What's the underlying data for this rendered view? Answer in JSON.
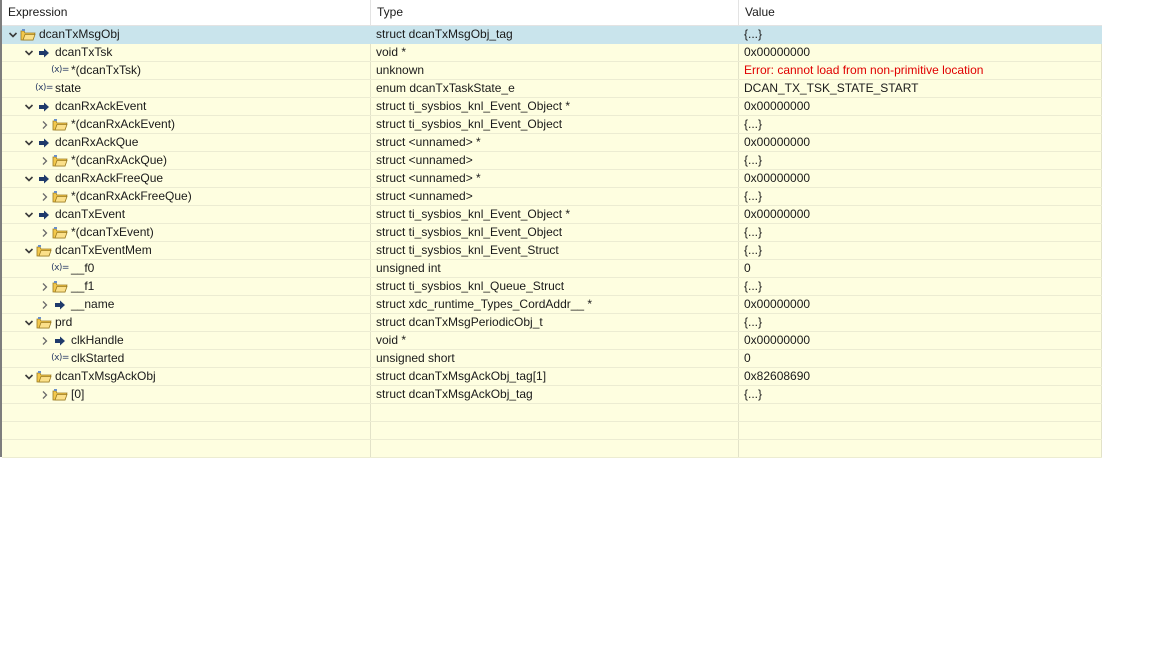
{
  "columns": {
    "expression": "Expression",
    "type": "Type",
    "value": "Value"
  },
  "rows": [
    {
      "depth": 0,
      "twisty": "expanded",
      "icon": "struct",
      "name": "dcanTxMsgObj",
      "type": "struct dcanTxMsgObj_tag",
      "value": "{...}",
      "selected": true
    },
    {
      "depth": 1,
      "twisty": "expanded",
      "icon": "pointer",
      "name": "dcanTxTsk",
      "type": "void *",
      "value": "0x00000000"
    },
    {
      "depth": 2,
      "twisty": "none",
      "icon": "variable",
      "name": "*(dcanTxTsk)",
      "type": "unknown",
      "value": "Error: cannot load from non-primitive location",
      "error": true
    },
    {
      "depth": 1,
      "twisty": "none",
      "icon": "variable",
      "name": "state",
      "type": "enum dcanTxTaskState_e",
      "value": "DCAN_TX_TSK_STATE_START"
    },
    {
      "depth": 1,
      "twisty": "expanded",
      "icon": "pointer",
      "name": "dcanRxAckEvent",
      "type": "struct ti_sysbios_knl_Event_Object *",
      "value": "0x00000000"
    },
    {
      "depth": 2,
      "twisty": "collapsed",
      "icon": "struct",
      "name": "*(dcanRxAckEvent)",
      "type": "struct ti_sysbios_knl_Event_Object",
      "value": "{...}"
    },
    {
      "depth": 1,
      "twisty": "expanded",
      "icon": "pointer",
      "name": "dcanRxAckQue",
      "type": "struct <unnamed> *",
      "value": "0x00000000"
    },
    {
      "depth": 2,
      "twisty": "collapsed",
      "icon": "struct",
      "name": "*(dcanRxAckQue)",
      "type": "struct <unnamed>",
      "value": "{...}"
    },
    {
      "depth": 1,
      "twisty": "expanded",
      "icon": "pointer",
      "name": "dcanRxAckFreeQue",
      "type": "struct <unnamed> *",
      "value": "0x00000000"
    },
    {
      "depth": 2,
      "twisty": "collapsed",
      "icon": "struct",
      "name": "*(dcanRxAckFreeQue)",
      "type": "struct <unnamed>",
      "value": "{...}"
    },
    {
      "depth": 1,
      "twisty": "expanded",
      "icon": "pointer",
      "name": "dcanTxEvent",
      "type": "struct ti_sysbios_knl_Event_Object *",
      "value": "0x00000000"
    },
    {
      "depth": 2,
      "twisty": "collapsed",
      "icon": "struct",
      "name": "*(dcanTxEvent)",
      "type": "struct ti_sysbios_knl_Event_Object",
      "value": "{...}"
    },
    {
      "depth": 1,
      "twisty": "expanded",
      "icon": "struct",
      "name": "dcanTxEventMem",
      "type": "struct ti_sysbios_knl_Event_Struct",
      "value": "{...}"
    },
    {
      "depth": 2,
      "twisty": "none",
      "icon": "variable",
      "name": "__f0",
      "type": "unsigned int",
      "value": "0"
    },
    {
      "depth": 2,
      "twisty": "collapsed",
      "icon": "struct",
      "name": "__f1",
      "type": "struct ti_sysbios_knl_Queue_Struct",
      "value": "{...}"
    },
    {
      "depth": 2,
      "twisty": "collapsed",
      "icon": "pointer",
      "name": "__name",
      "type": "struct xdc_runtime_Types_CordAddr__ *",
      "value": "0x00000000"
    },
    {
      "depth": 1,
      "twisty": "expanded",
      "icon": "struct",
      "name": "prd",
      "type": "struct dcanTxMsgPeriodicObj_t",
      "value": "{...}"
    },
    {
      "depth": 2,
      "twisty": "collapsed",
      "icon": "pointer",
      "name": "clkHandle",
      "type": "void *",
      "value": "0x00000000"
    },
    {
      "depth": 2,
      "twisty": "none",
      "icon": "variable",
      "name": "clkStarted",
      "type": "unsigned short",
      "value": "0"
    },
    {
      "depth": 1,
      "twisty": "expanded",
      "icon": "struct",
      "name": "dcanTxMsgAckObj",
      "type": "struct dcanTxMsgAckObj_tag[1]",
      "value": "0x82608690"
    },
    {
      "depth": 2,
      "twisty": "collapsed",
      "icon": "struct",
      "name": "[0]",
      "type": "struct dcanTxMsgAckObj_tag",
      "value": "{...}"
    },
    {
      "depth": 0,
      "twisty": "none",
      "icon": "none",
      "name": "",
      "type": "",
      "value": ""
    },
    {
      "depth": 0,
      "twisty": "none",
      "icon": "none",
      "name": "",
      "type": "",
      "value": ""
    },
    {
      "depth": 0,
      "twisty": "none",
      "icon": "none",
      "name": "",
      "type": "",
      "value": ""
    }
  ],
  "icons": {
    "variable_glyph": "(x)="
  },
  "colors": {
    "row_bg": "#fefee0",
    "selected_bg": "#c9e4ec",
    "error_text": "#e00000",
    "folder_fill": "#f3c84b",
    "pointer_fill": "#1f3a6b"
  }
}
